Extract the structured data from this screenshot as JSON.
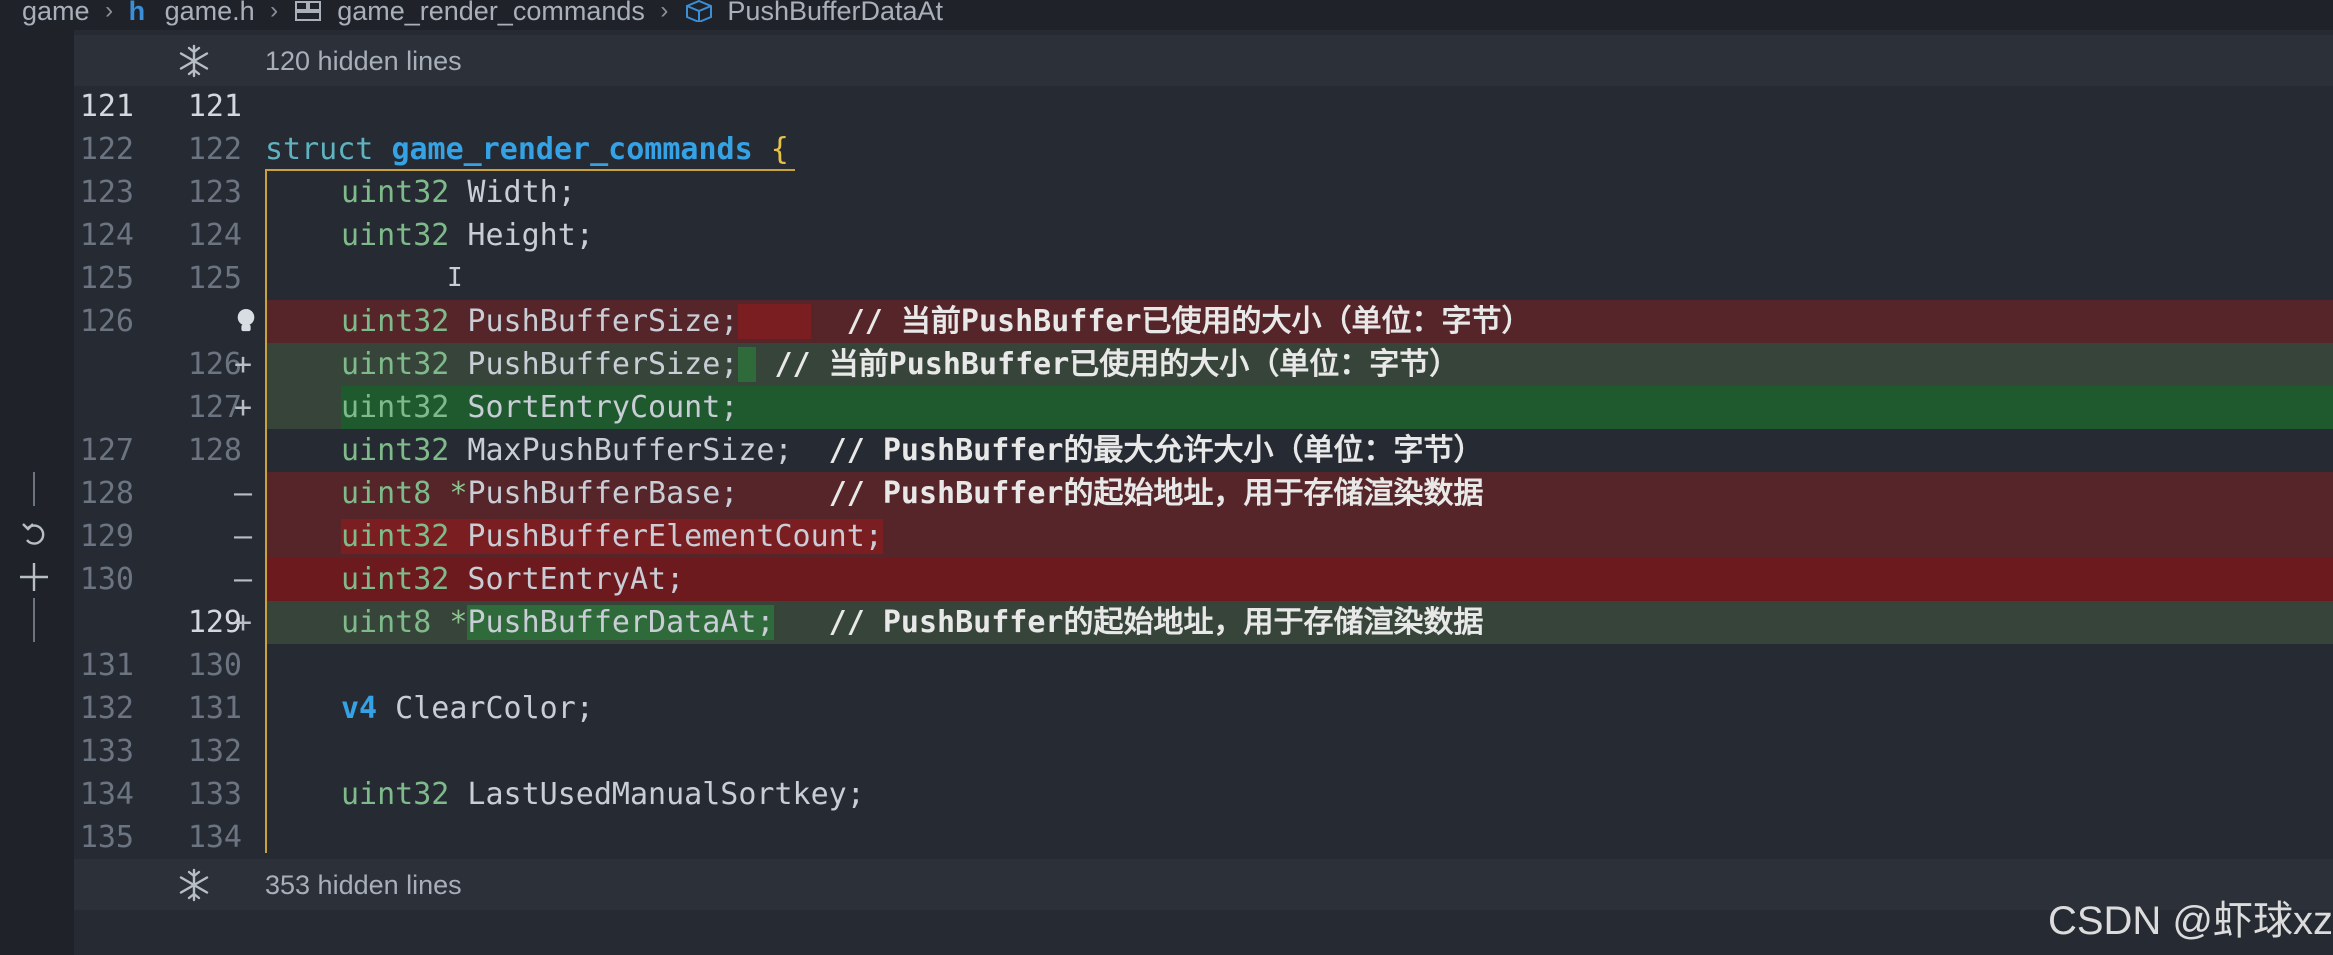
{
  "breadcrumb": {
    "items": [
      "game",
      "game.h",
      "game_render_commands",
      "PushBufferDataAt"
    ],
    "sep": ">"
  },
  "hidden_top": {
    "label": "120 hidden lines"
  },
  "hidden_bottom": {
    "label": "353 hidden lines"
  },
  "lines": {
    "l121": {
      "old": "121",
      "new": "121"
    },
    "l122": {
      "old": "122",
      "new": "122",
      "kw": "struct",
      "name": "game_render_commands",
      "brace": "{"
    },
    "l123": {
      "old": "123",
      "new": "123",
      "type": "uint32",
      "rest": " Width;"
    },
    "l124": {
      "old": "124",
      "new": "124",
      "type": "uint32",
      "rest": " Height;"
    },
    "l125": {
      "old": "125",
      "new": "125"
    },
    "l126del": {
      "old": "126",
      "type": "uint32",
      "rest": " PushBufferSize;",
      "comment": "// 当前PushBuffer已使用的大小（单位：字节）"
    },
    "l126add": {
      "new": "126",
      "mark": "+",
      "type": "uint32",
      "rest": " PushBufferSize;",
      "comment": "// 当前PushBuffer已使用的大小（单位：字节）"
    },
    "l127add": {
      "new": "127",
      "mark": "+",
      "type": "uint32",
      "rest": " SortEntryCount;"
    },
    "l127": {
      "old": "127",
      "new": "128",
      "type": "uint32",
      "rest": " MaxPushBufferSize;",
      "comment": "// PushBuffer的最大允许大小（单位：字节）"
    },
    "l128del": {
      "old": "128",
      "mark": "—",
      "type": "uint8",
      "op": "*",
      "rest": "PushBufferBase;",
      "comment": "// PushBuffer的起始地址，用于存储渲染数据"
    },
    "l129del": {
      "old": "129",
      "mark": "—",
      "type": "uint32",
      "rest": " PushBufferElementCount;"
    },
    "l130del": {
      "old": "130",
      "mark": "—",
      "type": "uint32",
      "rest": " SortEntryAt;"
    },
    "l129add": {
      "new": "129",
      "mark": "+",
      "type": "uint8",
      "op": "*",
      "rest": "PushBufferDataAt;",
      "comment": "// PushBuffer的起始地址，用于存储渲染数据"
    },
    "l131": {
      "old": "131",
      "new": "130"
    },
    "l132": {
      "old": "132",
      "new": "131",
      "kw": "v4",
      "rest": " ClearColor;"
    },
    "l133": {
      "old": "133",
      "new": "132"
    },
    "l134": {
      "old": "134",
      "new": "133",
      "type": "uint32",
      "rest": " LastUsedManualSortkey;"
    },
    "l135": {
      "old": "135",
      "new": "134"
    }
  },
  "icons": {
    "crumb_header": "header-file-icon",
    "crumb_struct": "struct-icon",
    "crumb_field": "field-cube-icon",
    "hidden": "snowflake-icon",
    "lightbulb": "lightbulb-icon",
    "revert": "undo-icon",
    "stage": "plus-icon"
  },
  "colors": {
    "deleted_bg": "#552529",
    "added_bg": "#37443a",
    "type": "#7fba8a",
    "struct_name": "#35a2e6"
  },
  "watermark": "CSDN @虾球xz"
}
